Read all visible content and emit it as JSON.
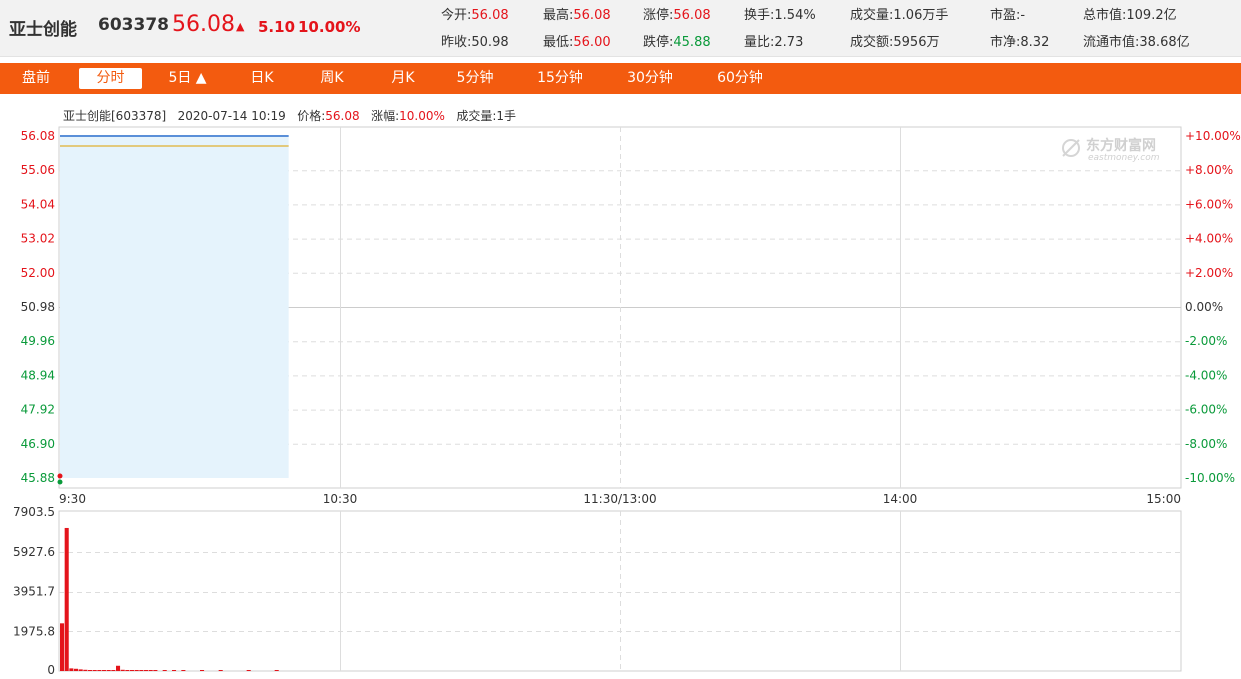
{
  "header": {
    "name": "亚士创能",
    "code": "603378",
    "price": "56.08",
    "arrow": "▲",
    "change": "5.10",
    "change_pct": "10.00%",
    "stats": [
      {
        "label": "今开:",
        "value": "56.08",
        "color": "red"
      },
      {
        "label": "最高:",
        "value": "56.08",
        "color": "red"
      },
      {
        "label": "涨停:",
        "value": "56.08",
        "color": "red"
      },
      {
        "label": "换手:",
        "value": "1.54%",
        "color": "plain"
      },
      {
        "label": "成交量:",
        "value": "1.06万手",
        "color": "plain"
      },
      {
        "label": "市盈:",
        "value": "-",
        "color": "plain"
      },
      {
        "label": "总市值:",
        "value": "109.2亿",
        "color": "plain"
      },
      {
        "label": "昨收:",
        "value": "50.98",
        "color": "plain"
      },
      {
        "label": "最低:",
        "value": "56.00",
        "color": "red"
      },
      {
        "label": "跌停:",
        "value": "45.88",
        "color": "green"
      },
      {
        "label": "量比:",
        "value": "2.73",
        "color": "plain"
      },
      {
        "label": "成交额:",
        "value": "5956万",
        "color": "plain"
      },
      {
        "label": "市净:",
        "value": "8.32",
        "color": "plain"
      },
      {
        "label": "流通市值:",
        "value": "38.68亿",
        "color": "plain"
      }
    ]
  },
  "nav": {
    "tabs": [
      "盘前",
      "分时",
      "5日 ▲",
      "日K",
      "周K",
      "月K",
      "5分钟",
      "15分钟",
      "30分钟",
      "60分钟"
    ],
    "active_index": 1
  },
  "info_line": {
    "name_code": "亚士创能[603378]",
    "datetime": "2020-07-14 10:19",
    "price_label": "价格:",
    "price": "56.08",
    "change_label": "涨幅:",
    "change": "10.00%",
    "volume_label": "成交量:",
    "volume": "1手"
  },
  "watermark": {
    "cn": "东方财富网",
    "en": "eastmoney.com"
  },
  "colors": {
    "up": "#e4141b",
    "down": "#0a9a3a",
    "accent": "#f35b0f",
    "price_line": "#5a8fd8",
    "avg_line": "#e0b030",
    "area_fill": "#e5f3fc"
  },
  "chart_data": {
    "type": "line",
    "price_axis": {
      "ticks": [
        "56.08",
        "55.06",
        "54.04",
        "53.02",
        "52.00",
        "50.98",
        "49.96",
        "48.94",
        "47.92",
        "46.90",
        "45.88"
      ],
      "pct_ticks": [
        "+10.00%",
        "+8.00%",
        "+6.00%",
        "+4.00%",
        "+2.00%",
        "0.00%",
        "-2.00%",
        "-4.00%",
        "-6.00%",
        "-8.00%",
        "-10.00%"
      ],
      "ylim": [
        45.88,
        56.08
      ],
      "prev_close": 50.98
    },
    "time_axis": {
      "labels": [
        "9:30",
        "10:30",
        "11:30/13:00",
        "14:00",
        "15:00"
      ],
      "total_minutes": 240,
      "elapsed_minutes": 49
    },
    "series": [
      {
        "name": "价格",
        "start_minute": 0,
        "end_minute": 49,
        "value": 56.08
      },
      {
        "name": "均价",
        "start_minute": 0,
        "end_minute": 49,
        "value": 56.02
      }
    ],
    "volume": {
      "ticks": [
        "7903.5",
        "5927.6",
        "3951.7",
        "1975.8",
        "0"
      ],
      "ylim": [
        0,
        7903.5
      ],
      "bars": [
        {
          "minute": 0,
          "value": 2370
        },
        {
          "minute": 1,
          "value": 7110
        },
        {
          "minute": 2,
          "value": 130
        },
        {
          "minute": 3,
          "value": 110
        },
        {
          "minute": 4,
          "value": 80
        },
        {
          "minute": 5,
          "value": 60
        },
        {
          "minute": 6,
          "value": 40
        },
        {
          "minute": 7,
          "value": 30
        },
        {
          "minute": 8,
          "value": 25
        },
        {
          "minute": 9,
          "value": 20
        },
        {
          "minute": 10,
          "value": 15
        },
        {
          "minute": 11,
          "value": 20
        },
        {
          "minute": 12,
          "value": 260
        },
        {
          "minute": 13,
          "value": 60
        },
        {
          "minute": 14,
          "value": 40
        },
        {
          "minute": 15,
          "value": 20
        },
        {
          "minute": 16,
          "value": 15
        },
        {
          "minute": 17,
          "value": 10
        },
        {
          "minute": 18,
          "value": 10
        },
        {
          "minute": 19,
          "value": 10
        },
        {
          "minute": 20,
          "value": 10
        },
        {
          "minute": 22,
          "value": 10
        },
        {
          "minute": 24,
          "value": 10
        },
        {
          "minute": 26,
          "value": 10
        },
        {
          "minute": 30,
          "value": 15
        },
        {
          "minute": 34,
          "value": 10
        },
        {
          "minute": 40,
          "value": 10
        },
        {
          "minute": 46,
          "value": 10
        }
      ]
    }
  }
}
